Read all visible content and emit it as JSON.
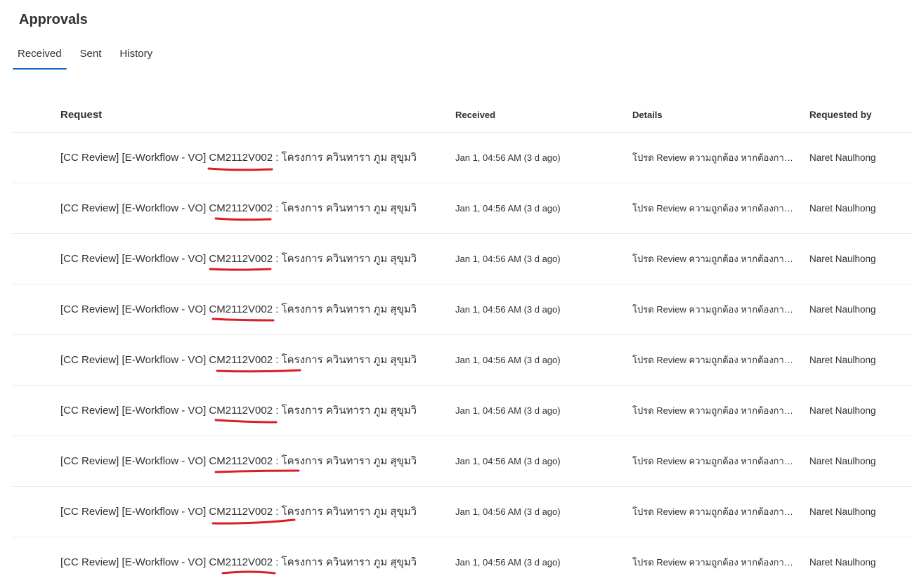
{
  "page": {
    "title": "Approvals"
  },
  "tabs": [
    {
      "label": "Received",
      "active": true
    },
    {
      "label": "Sent",
      "active": false
    },
    {
      "label": "History",
      "active": false
    }
  ],
  "table": {
    "columns": [
      "Request",
      "Received",
      "Details",
      "Requested by"
    ],
    "rows": [
      {
        "request_prefix": "[CC Review] [E-Workflow - VO] ",
        "request_code": "CM2112V002",
        "request_suffix": " : โครงการ ควินทารา ภูม สุขุมวิ",
        "received": "Jan 1, 04:56 AM (3 d ago)",
        "details": "โปรด Review ความถูกต้อง หากต้องการ...",
        "requested_by": "Naret Naulhong"
      },
      {
        "request_prefix": "[CC Review] [E-Workflow - VO] ",
        "request_code": "CM2112V002",
        "request_suffix": " : โครงการ ควินทารา ภูม สุขุมวิ",
        "received": "Jan 1, 04:56 AM (3 d ago)",
        "details": "โปรด Review ความถูกต้อง หากต้องการ...",
        "requested_by": "Naret Naulhong"
      },
      {
        "request_prefix": "[CC Review] [E-Workflow - VO] ",
        "request_code": "CM2112V002",
        "request_suffix": " : โครงการ ควินทารา ภูม สุขุมวิ",
        "received": "Jan 1, 04:56 AM (3 d ago)",
        "details": "โปรด Review ความถูกต้อง หากต้องการ...",
        "requested_by": "Naret Naulhong"
      },
      {
        "request_prefix": "[CC Review] [E-Workflow - VO] ",
        "request_code": "CM2112V002",
        "request_suffix": " : โครงการ ควินทารา ภูม สุขุมวิ",
        "received": "Jan 1, 04:56 AM (3 d ago)",
        "details": "โปรด Review ความถูกต้อง หากต้องการ...",
        "requested_by": "Naret Naulhong"
      },
      {
        "request_prefix": "[CC Review] [E-Workflow - VO] ",
        "request_code": "CM2112V002",
        "request_suffix": " : โครงการ ควินทารา ภูม สุขุมวิ",
        "received": "Jan 1, 04:56 AM (3 d ago)",
        "details": "โปรด Review ความถูกต้อง หากต้องการ...",
        "requested_by": "Naret Naulhong"
      },
      {
        "request_prefix": "[CC Review] [E-Workflow - VO] ",
        "request_code": "CM2112V002",
        "request_suffix": " : โครงการ ควินทารา ภูม สุขุมวิ",
        "received": "Jan 1, 04:56 AM (3 d ago)",
        "details": "โปรด Review ความถูกต้อง หากต้องการ...",
        "requested_by": "Naret Naulhong"
      },
      {
        "request_prefix": "[CC Review] [E-Workflow - VO] ",
        "request_code": "CM2112V002",
        "request_suffix": " : โครงการ ควินทารา ภูม สุขุมวิ",
        "received": "Jan 1, 04:56 AM (3 d ago)",
        "details": "โปรด Review ความถูกต้อง หากต้องการ...",
        "requested_by": "Naret Naulhong"
      },
      {
        "request_prefix": "[CC Review] [E-Workflow - VO] ",
        "request_code": "CM2112V002",
        "request_suffix": " : โครงการ ควินทารา ภูม สุขุมวิ",
        "received": "Jan 1, 04:56 AM (3 d ago)",
        "details": "โปรด Review ความถูกต้อง หากต้องการ...",
        "requested_by": "Naret Naulhong"
      },
      {
        "request_prefix": "[CC Review] [E-Workflow - VO] ",
        "request_code": "CM2112V002",
        "request_suffix": " : โครงการ ควินทารา ภูม สุขุมวิ",
        "received": "Jan 1, 04:56 AM (3 d ago)",
        "details": "โปรด Review ความถูกต้อง หากต้องการ...",
        "requested_by": "Naret Naulhong"
      }
    ]
  },
  "annotation": {
    "underline_color": "#d81f26"
  }
}
